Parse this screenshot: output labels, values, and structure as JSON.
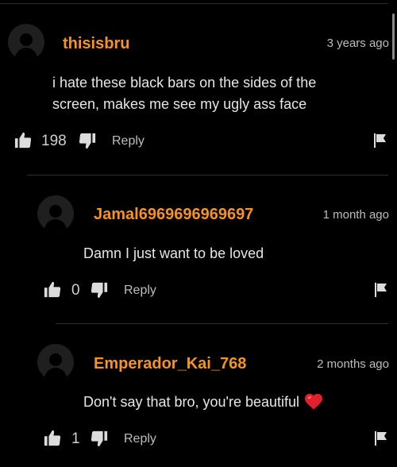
{
  "comments": [
    {
      "username": "thisisbru",
      "time": "3 years ago",
      "text": "i hate these black bars on the sides of the screen, makes me see my ugly ass face",
      "likes": "198",
      "reply_label": "Reply"
    },
    {
      "username": "Jamal6969696969697",
      "time": "1 month ago",
      "text": "Damn I just want to be loved",
      "likes": "0",
      "reply_label": "Reply"
    },
    {
      "username": "Emperador_Kai_768",
      "time": "2 months ago",
      "text": "Don't say that bro, you're beautiful",
      "emoji": "red-heart",
      "likes": "1",
      "reply_label": "Reply"
    }
  ],
  "colors": {
    "background": "#000000",
    "username": "#f7931e",
    "text": "#e6e6e6",
    "muted": "#bdbdbd",
    "heart": "#e0202a"
  },
  "icons": [
    "avatar-placeholder",
    "thumbs-up-icon",
    "thumbs-down-icon",
    "flag-icon",
    "heart-emoji"
  ]
}
